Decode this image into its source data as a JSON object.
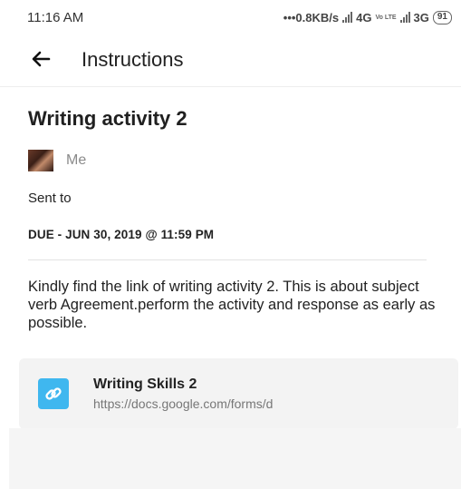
{
  "status_bar": {
    "time": "11:16 AM",
    "speed": "•••0.8KB/s",
    "network_1": "4G",
    "volte": "Vo LTE",
    "network_2": "3G",
    "battery": "91"
  },
  "app_bar": {
    "back_icon": "arrow-left-icon",
    "title": "Instructions"
  },
  "assignment": {
    "title": "Writing activity 2",
    "author": "Me",
    "sent_to_label": "Sent to",
    "due": "DUE - JUN 30, 2019 @ 11:59 PM",
    "description": "Kindly find the link of writing activity 2. This is about subject verb Agreement.perform the activity and response as early as possible."
  },
  "attachment": {
    "icon": "link-icon",
    "title": "Writing Skills 2",
    "url": "https://docs.google.com/forms/d"
  },
  "colors": {
    "link_icon_bg": "#3fb7ef",
    "attachment_bg": "#f3f3f3"
  }
}
